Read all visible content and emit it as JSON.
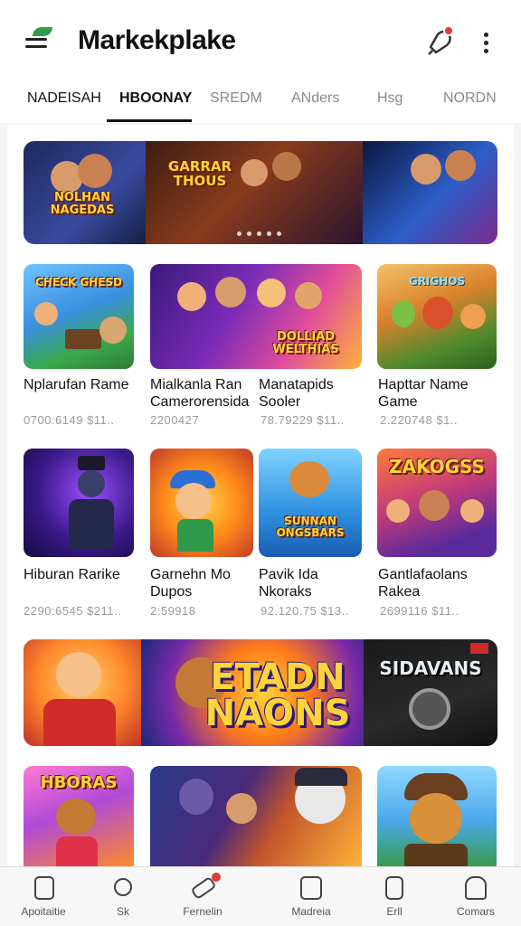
{
  "app": {
    "title": "Markekplake"
  },
  "header": {
    "menu_icon": "menu-icon",
    "notification_icon": "notification-bell-icon",
    "more_icon": "more-vertical-icon",
    "notification_badge_color": "#e53935"
  },
  "tabs": [
    {
      "label": "NADEISAH",
      "active": false
    },
    {
      "label": "HBOONAY",
      "active": true
    },
    {
      "label": "SREDM",
      "active": false
    },
    {
      "label": "ANders",
      "active": false
    },
    {
      "label": "Hsg",
      "active": false
    },
    {
      "label": "NORDN",
      "active": false
    }
  ],
  "banners": {
    "top": {
      "left_text": "NOLHAN NAGEDAS",
      "center_text": "GARRAR THOUS"
    },
    "middle": {
      "center_text": "ETADN NAONS",
      "right_text": "SIDAVANS"
    }
  },
  "games_row1": [
    {
      "name": "Nplarufan Rame",
      "meta": "0700:6149  $11..",
      "cover_text": "CHECK GHESD"
    },
    {
      "name": "Mialkanla Ran Camerorensida",
      "meta": "2200427",
      "cover_text": "DOLLIAD WELTHIAS"
    },
    {
      "name": "Manatapids Sooler",
      "meta": "78.79229  $11..",
      "cover_text": ""
    },
    {
      "name": "Hapttar Name Game",
      "meta": "2.220748  $1..",
      "cover_text": "GRIGHOS"
    }
  ],
  "games_row2": [
    {
      "name": "Hiburan Rarike",
      "meta": "2290:6545  $211..",
      "cover_text": ""
    },
    {
      "name": "Garnehn Mo Dupos",
      "meta": "2:59918",
      "cover_text": ""
    },
    {
      "name": "Pavik Ida Nkoraks",
      "meta": "92.120.75  $13..",
      "cover_text": "SUNNAN ONGSBARS"
    },
    {
      "name": "Gantlafaolans Rakea",
      "meta": "2699116  $11..",
      "cover_text": "ZAKOGSS"
    }
  ],
  "games_row4": [
    {
      "cover_text": "HBORAS"
    },
    {
      "cover_text": ""
    },
    {
      "cover_text": ""
    }
  ],
  "bottom_nav": [
    {
      "label": "Apoitaitie",
      "icon": "tablet-icon"
    },
    {
      "label": "Sk",
      "icon": "search-icon"
    },
    {
      "label": "Fernelin",
      "icon": "hammer-icon"
    },
    {
      "label": "Madreia",
      "icon": "document-icon"
    },
    {
      "label": "Erll",
      "icon": "phone-icon"
    },
    {
      "label": "Comars",
      "icon": "person-icon"
    }
  ]
}
